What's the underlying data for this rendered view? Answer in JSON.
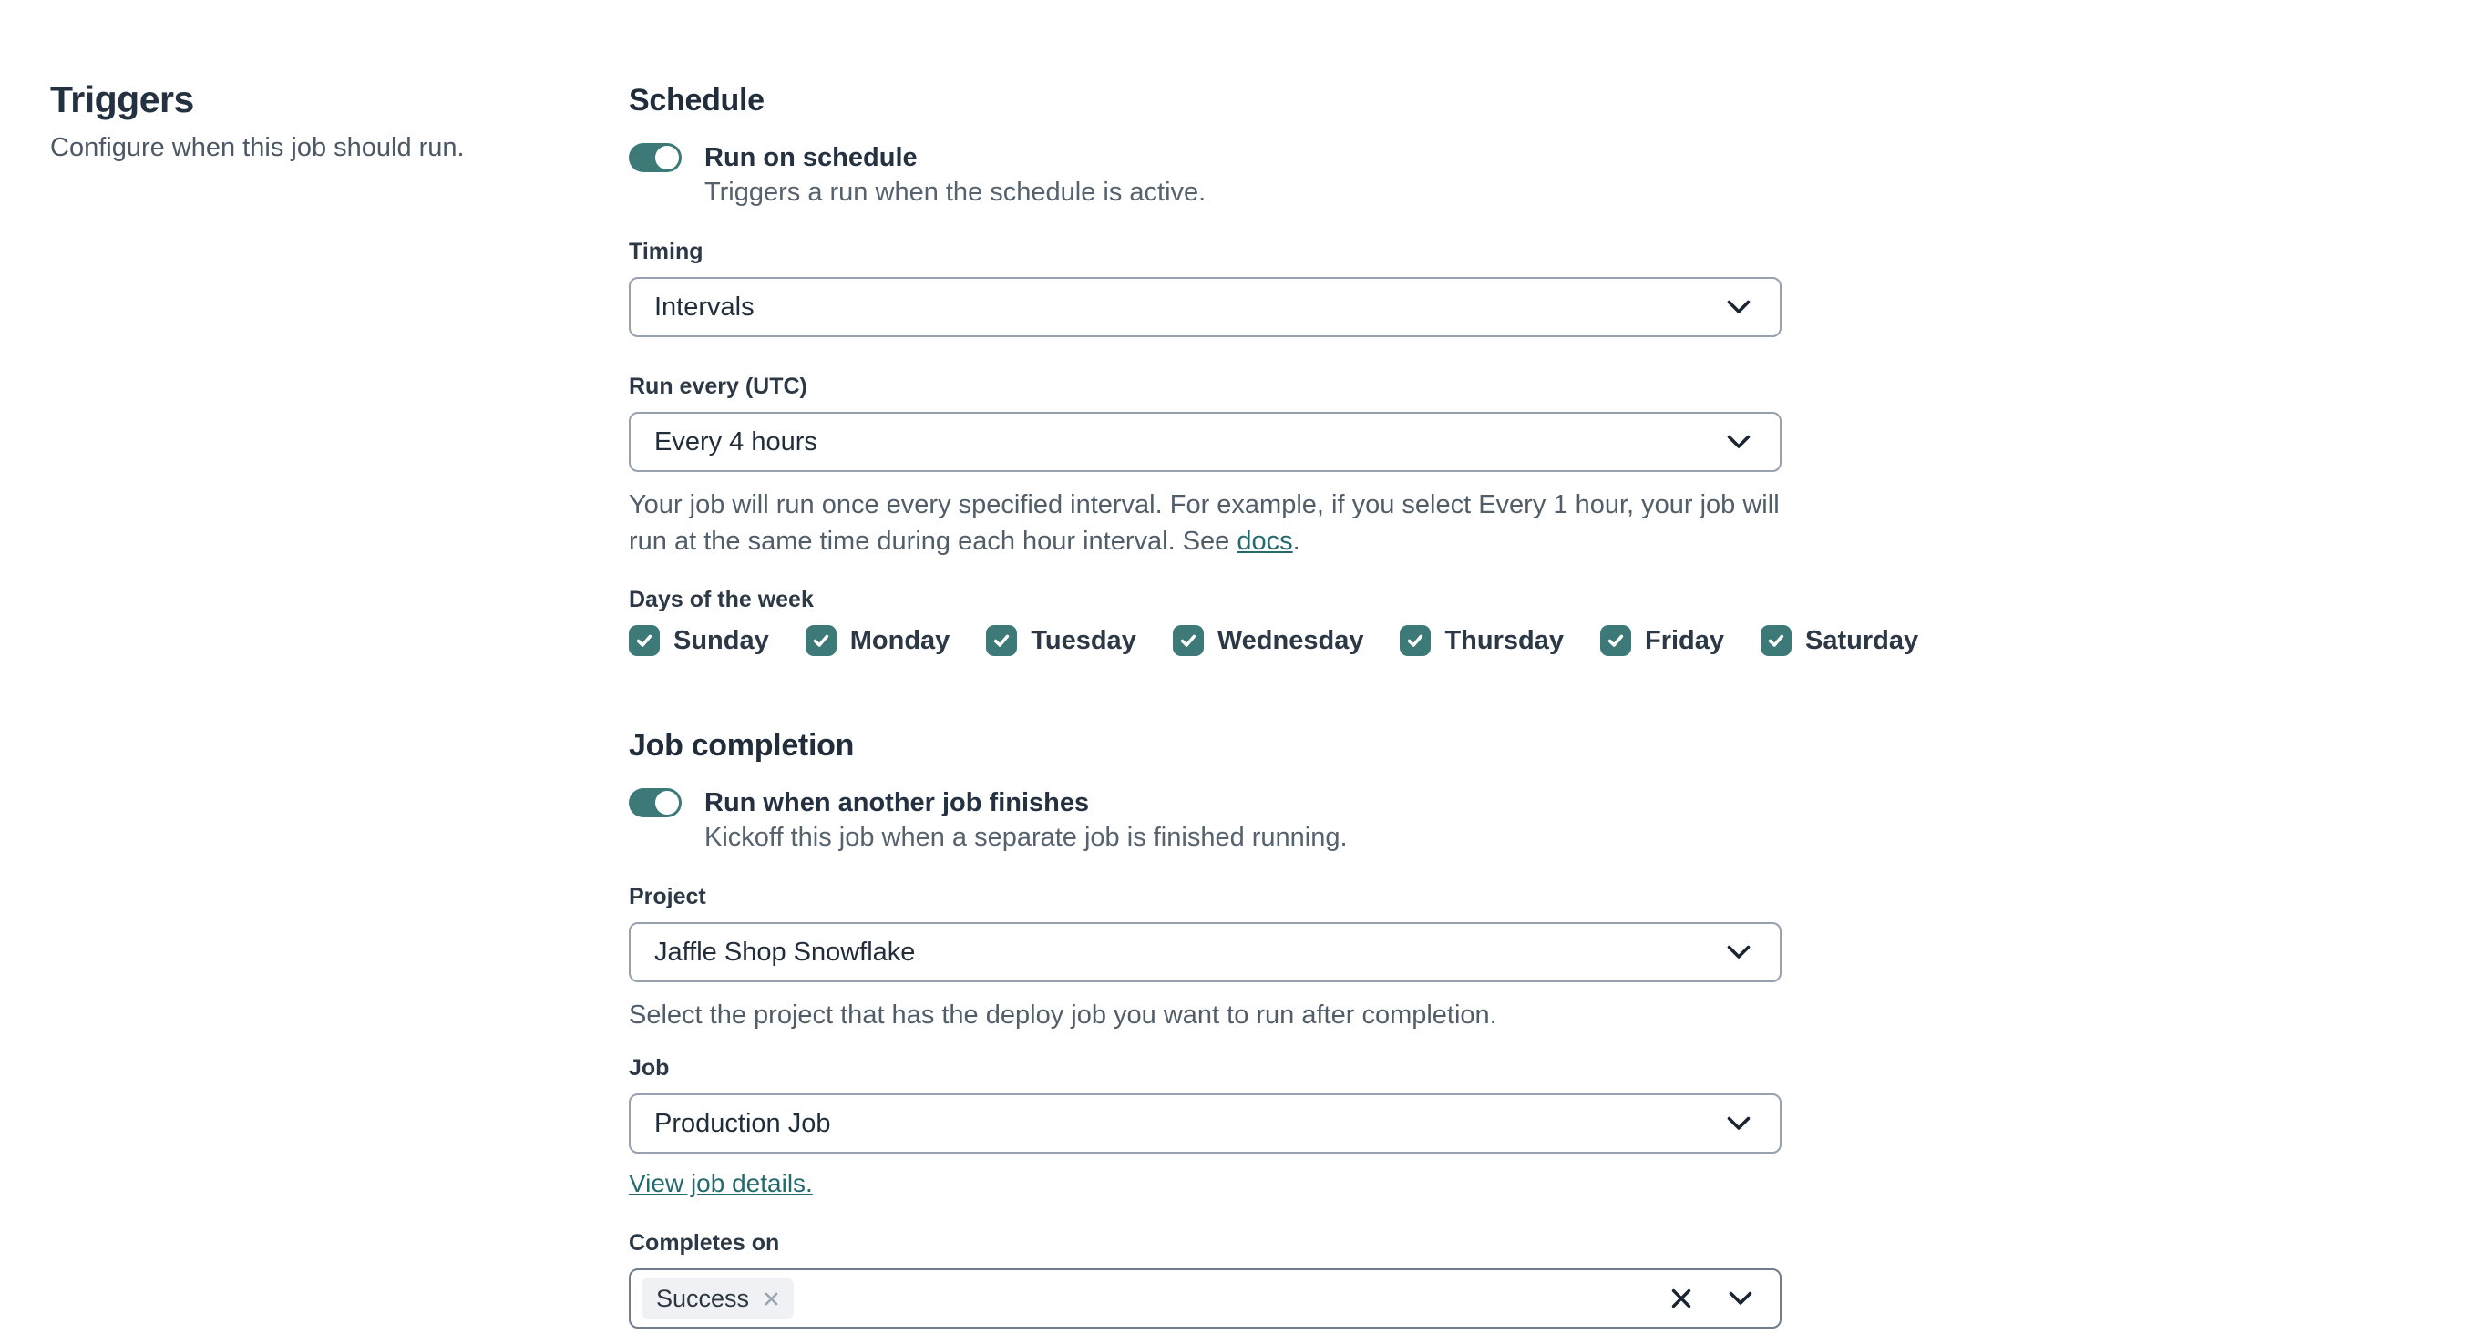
{
  "colors": {
    "accent_teal": "#3d7a77",
    "link_teal": "#256a6e",
    "text_dark": "#243140",
    "text_gray": "#56626e",
    "field_border": "#97a1af",
    "tag_bg": "#eff1f4"
  },
  "intro": {
    "title": "Triggers",
    "subtitle": "Configure when this job should run."
  },
  "schedule": {
    "heading": "Schedule",
    "toggle": {
      "label": "Run on schedule",
      "description": "Triggers a run when the schedule is active.",
      "state": "on"
    },
    "timing": {
      "label": "Timing",
      "value": "Intervals"
    },
    "run_every": {
      "label": "Run every (UTC)",
      "value": "Every 4 hours",
      "help_before_link": "Your job will run once every specified interval. For example, if you select Every 1 hour, your job will run at the same time during each hour interval. See ",
      "help_link": "docs",
      "help_after_link": "."
    },
    "days": {
      "label": "Days of the week",
      "items": [
        {
          "label": "Sunday",
          "checked": true
        },
        {
          "label": "Monday",
          "checked": true
        },
        {
          "label": "Tuesday",
          "checked": true
        },
        {
          "label": "Wednesday",
          "checked": true
        },
        {
          "label": "Thursday",
          "checked": true
        },
        {
          "label": "Friday",
          "checked": true
        },
        {
          "label": "Saturday",
          "checked": true
        }
      ]
    }
  },
  "job_completion": {
    "heading": "Job completion",
    "toggle": {
      "label": "Run when another job finishes",
      "description": "Kickoff this job when a separate job is finished running.",
      "state": "on"
    },
    "project": {
      "label": "Project",
      "value": "Jaffle Shop Snowflake",
      "help": "Select the project that has the deploy job you want to run after completion."
    },
    "job": {
      "label": "Job",
      "value": "Production Job",
      "link": "View job details."
    },
    "completes_on": {
      "label": "Completes on",
      "tags": [
        {
          "label": "Success"
        }
      ]
    }
  }
}
